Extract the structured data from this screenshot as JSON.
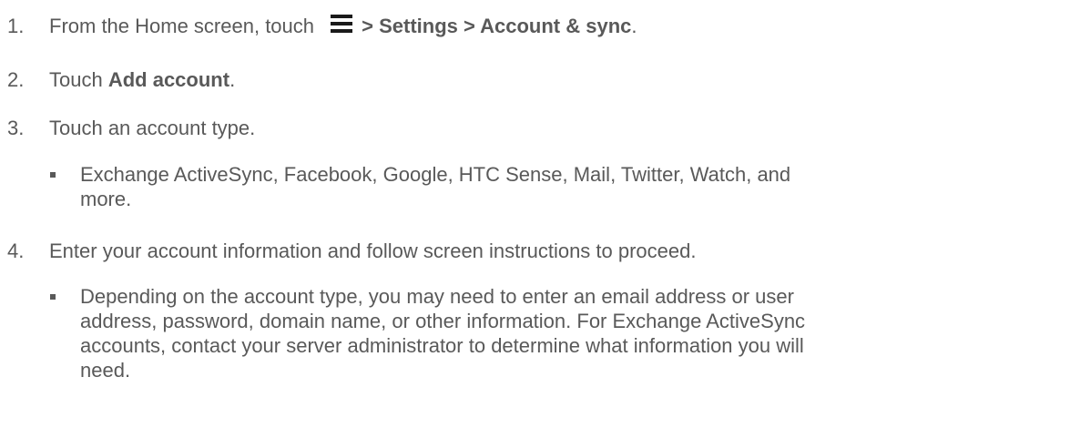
{
  "steps": [
    {
      "num": "1.",
      "prefix": "From the Home screen, touch ",
      "icon": "menu-icon",
      "path": "> Settings > Account & sync",
      "suffix": "."
    },
    {
      "num": "2.",
      "prefix": "Touch ",
      "bold": "Add account",
      "suffix": "."
    },
    {
      "num": "3.",
      "text": "Touch an account type.",
      "bullet_lines": [
        "Exchange ActiveSync, Facebook, Google, HTC Sense, Mail, Twitter, Watch, and",
        "more."
      ]
    },
    {
      "num": "4.",
      "text": "Enter your account information and follow screen instructions to proceed.",
      "bullet_lines": [
        "Depending on the account type, you may need to enter an email address or user",
        "address, password, domain name, or other information. For Exchange ActiveSync",
        "accounts, contact your server administrator to determine what information you will",
        "need."
      ]
    }
  ]
}
